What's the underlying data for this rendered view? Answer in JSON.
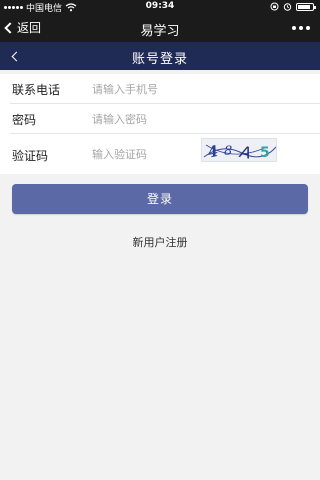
{
  "status_bar": {
    "carrier": "中国电信",
    "time": "09:34"
  },
  "wx_header": {
    "back_label": "返回",
    "title": "易学习"
  },
  "page_header": {
    "title": "账号登录"
  },
  "form": {
    "phone": {
      "label": "联系电话",
      "placeholder": "请输入手机号"
    },
    "password": {
      "label": "密码",
      "placeholder": "请输入密码"
    },
    "captcha": {
      "label": "验证码",
      "placeholder": "输入验证码",
      "image_text": "48A5"
    }
  },
  "actions": {
    "login_label": "登录",
    "register_label": "新用户注册"
  },
  "colors": {
    "status_bg": "#1b1b1b",
    "page_header_bg": "#1f2a55",
    "login_button_bg": "#5b6aa6",
    "page_bg": "#f2f2f2"
  }
}
